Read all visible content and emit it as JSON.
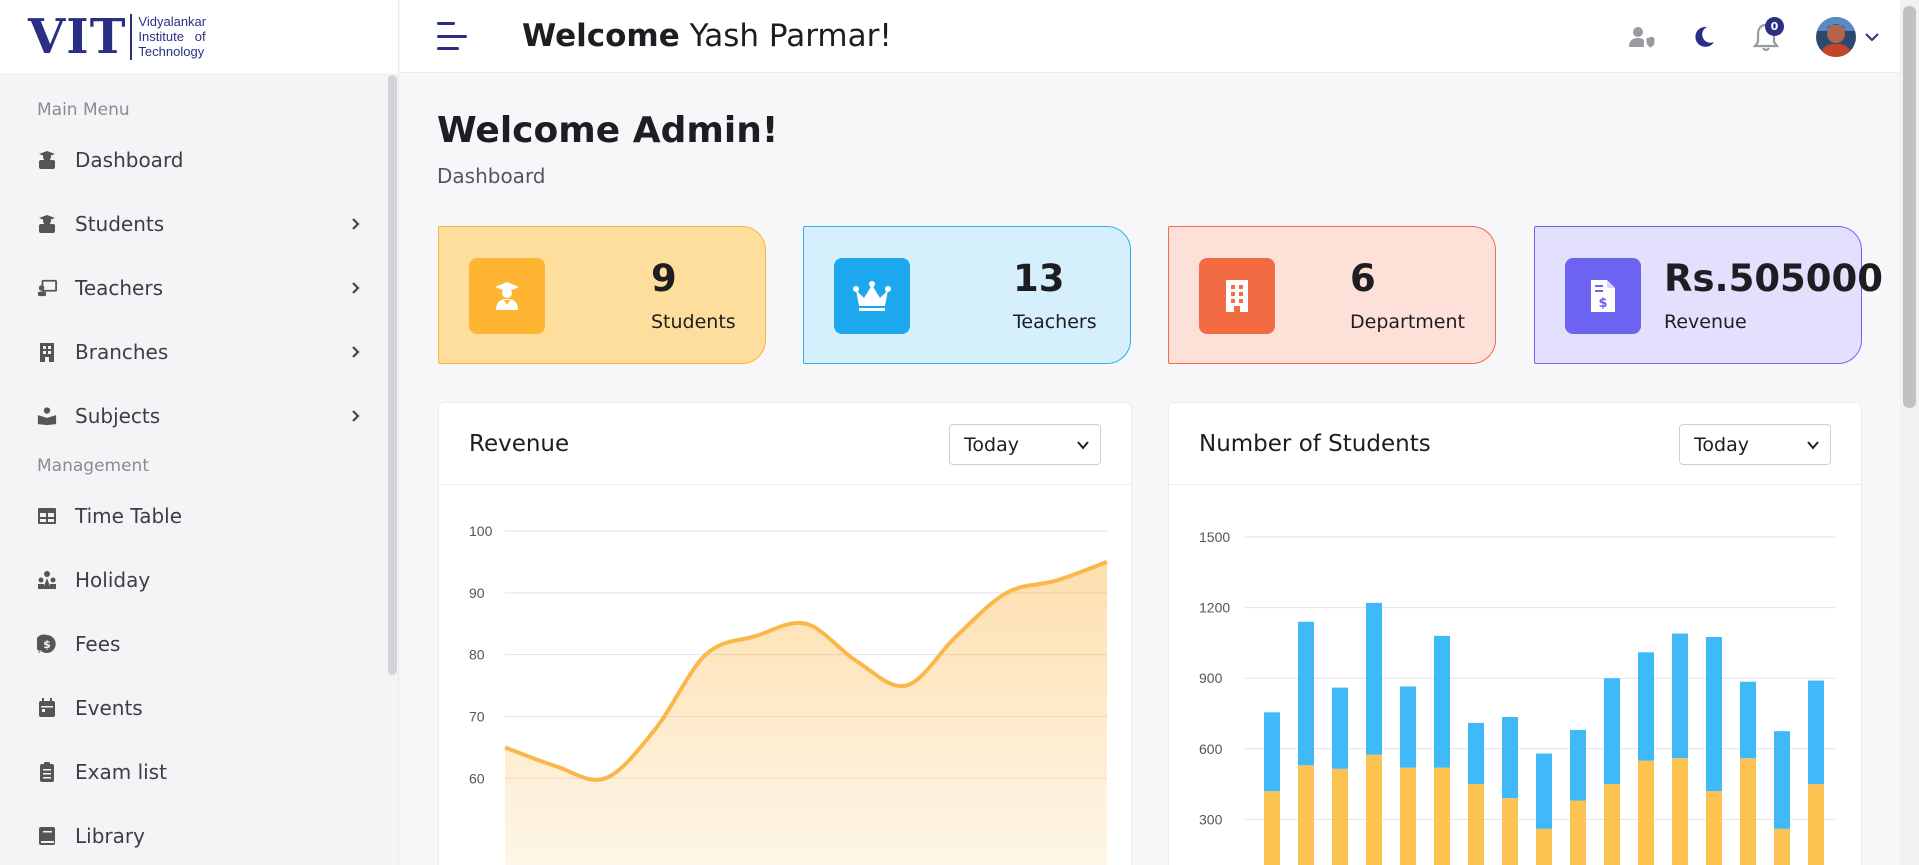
{
  "logo": {
    "mark": "VIT",
    "line1": "Vidyalankar",
    "line2": "Institute   of",
    "line3": "Technology"
  },
  "header": {
    "welcome_bold": "Welcome",
    "welcome_name": "Yash Parmar!",
    "notif_count": "0"
  },
  "sidebar": {
    "section_main": "Main Menu",
    "section_management": "Management",
    "main_items": [
      {
        "label": "Dashboard",
        "icon": "graduate-icon",
        "has_chevron": false
      },
      {
        "label": "Students",
        "icon": "graduate-icon",
        "has_chevron": true
      },
      {
        "label": "Teachers",
        "icon": "teacher-board-icon",
        "has_chevron": true
      },
      {
        "label": "Branches",
        "icon": "building-icon",
        "has_chevron": true
      },
      {
        "label": "Subjects",
        "icon": "book-reader-icon",
        "has_chevron": true
      }
    ],
    "management_items": [
      {
        "label": "Time Table",
        "icon": "table-icon"
      },
      {
        "label": "Holiday",
        "icon": "people-icon"
      },
      {
        "label": "Fees",
        "icon": "coin-chat-icon"
      },
      {
        "label": "Events",
        "icon": "calendar-icon"
      },
      {
        "label": "Exam list",
        "icon": "clipboard-icon"
      },
      {
        "label": "Library",
        "icon": "book-icon"
      }
    ]
  },
  "main": {
    "title": "Welcome Admin!",
    "breadcrumb": "Dashboard"
  },
  "stats": [
    {
      "value": "9",
      "label": "Students",
      "icon": "graduate-icon",
      "bg": "#fdde9c",
      "border": "#f9b53c",
      "icon_bg": "#fdb531"
    },
    {
      "value": "13",
      "label": "Teachers",
      "icon": "crown-icon",
      "bg": "#d5effd",
      "border": "#2bb1ec",
      "icon_bg": "#1ba8ef"
    },
    {
      "value": "6",
      "label": "Department",
      "icon": "building-icon",
      "bg": "#fde0d8",
      "border": "#f16b4c",
      "icon_bg": "#f26b43"
    },
    {
      "value": "Rs.505000",
      "label": "Revenue",
      "icon": "invoice-dollar-icon",
      "bg": "#e2e0fd",
      "border": "#6e66f3",
      "icon_bg": "#6c63f0"
    }
  ],
  "panels": {
    "revenue": {
      "title": "Revenue",
      "select": "Today"
    },
    "students": {
      "title": "Number of Students",
      "select": "Today"
    }
  },
  "chart_data": [
    {
      "type": "area",
      "title": "Revenue",
      "yticks": [
        100,
        90,
        80,
        70,
        60
      ],
      "ylim": [
        45,
        100
      ],
      "x": [
        0,
        1,
        2,
        3,
        4,
        5,
        6,
        7,
        8,
        9,
        10,
        11,
        12
      ],
      "values": [
        65,
        62,
        60,
        68,
        80,
        83,
        85,
        79,
        75,
        83,
        90,
        92,
        95
      ],
      "color": "#fbb84a",
      "grid": true
    },
    {
      "type": "bar",
      "stacked": true,
      "title": "Number of Students",
      "yticks": [
        1500,
        1200,
        900,
        600,
        300
      ],
      "ylim": [
        0,
        1500
      ],
      "series": [
        {
          "color": "#fcc350",
          "values": [
            420,
            530,
            515,
            575,
            520,
            520,
            450,
            390,
            260,
            380,
            450,
            550,
            560,
            420,
            560,
            260,
            450
          ]
        },
        {
          "color": "#40b9f8",
          "values": [
            335,
            610,
            345,
            645,
            345,
            560,
            260,
            345,
            320,
            300,
            450,
            460,
            530,
            655,
            325,
            415,
            440
          ]
        }
      ],
      "grid": true
    }
  ]
}
